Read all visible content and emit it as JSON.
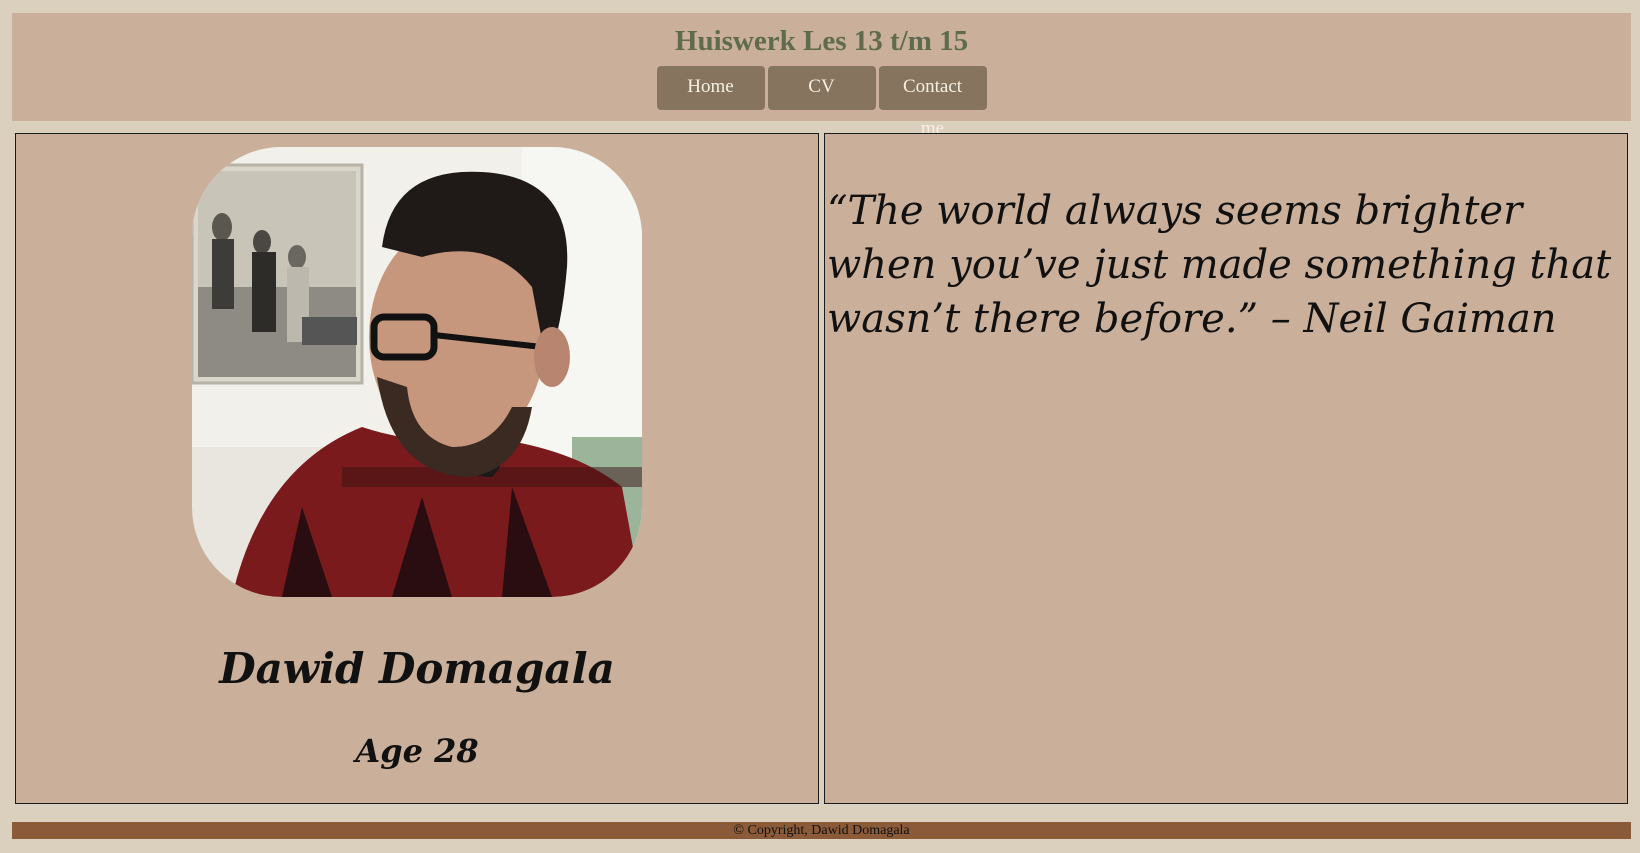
{
  "header": {
    "title": "Huiswerk Les 13 t/m 15",
    "nav": [
      {
        "label": "Home"
      },
      {
        "label": "CV"
      },
      {
        "label": "Contact me"
      }
    ]
  },
  "profile": {
    "photo_alt": "Portrait photo",
    "name": "Dawid Domagala",
    "age": "Age 28"
  },
  "quote": {
    "text": "“The world always seems brighter when you’ve just made something that wasn’t there before.” – Neil Gaiman"
  },
  "footer": {
    "text": "© Copyright, Dawid Domagala"
  },
  "colors": {
    "page_bg": "#dbcfbd",
    "panel_bg": "#cab09a",
    "nav_button": "#86745f",
    "title": "#5e6b4d",
    "footer_bg": "#8b5a38"
  }
}
